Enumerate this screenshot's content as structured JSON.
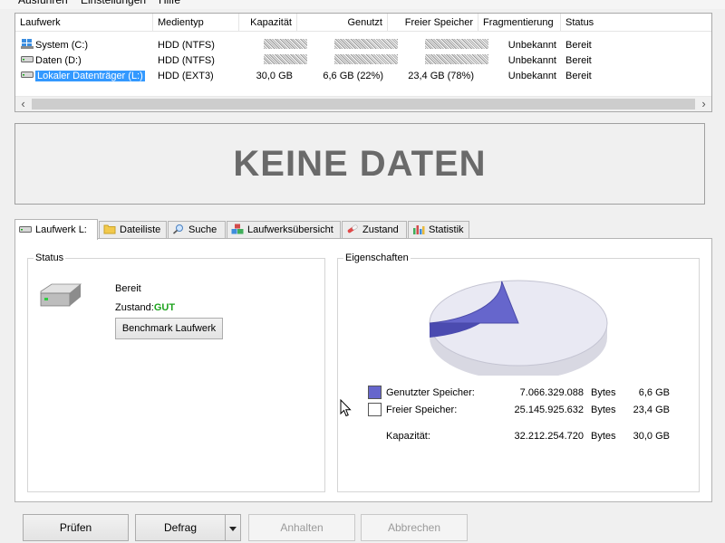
{
  "menu": {
    "items": [
      "Ausführen",
      "Einstellungen",
      "Hilfe"
    ]
  },
  "drive_list": {
    "columns": [
      "Laufwerk",
      "Medientyp",
      "Kapazität",
      "Genutzt",
      "Freier Speicher",
      "Fragmentierung",
      "Status"
    ],
    "rows": [
      {
        "laufwerk": "System (C:)",
        "medientyp": "HDD (NTFS)",
        "kapazitaet": "",
        "genutzt": "",
        "frei": "",
        "fragmentierung": "Unbekannt",
        "status": "Bereit",
        "icon": "windows-drive-icon",
        "selected": false,
        "redacted": true
      },
      {
        "laufwerk": "Daten (D:)",
        "medientyp": "HDD (NTFS)",
        "kapazitaet": "",
        "genutzt": "",
        "frei": "",
        "fragmentierung": "Unbekannt",
        "status": "Bereit",
        "icon": "hard-drive-icon",
        "selected": false,
        "redacted": true
      },
      {
        "laufwerk": "Lokaler Datenträger (L:)",
        "medientyp": "HDD (EXT3)",
        "kapazitaet": "30,0 GB",
        "genutzt": "6,6 GB (22%)",
        "frei": "23,4 GB (78%)",
        "fragmentierung": "Unbekannt",
        "status": "Bereit",
        "icon": "hard-drive-icon",
        "selected": true,
        "redacted": false
      }
    ]
  },
  "banner": {
    "text": "KEINE DATEN"
  },
  "tabs": [
    {
      "label": "Laufwerk L:",
      "icon": "drive-icon",
      "active": true
    },
    {
      "label": "Dateiliste",
      "icon": "folder-icon",
      "active": false
    },
    {
      "label": "Suche",
      "icon": "magnifier-icon",
      "active": false
    },
    {
      "label": "Laufwerksübersicht",
      "icon": "blocks-icon",
      "active": false
    },
    {
      "label": "Zustand",
      "icon": "health-icon",
      "active": false
    },
    {
      "label": "Statistik",
      "icon": "bar-chart-icon",
      "active": false
    }
  ],
  "status_group": {
    "title": "Status",
    "state": "Bereit",
    "condition_label": "Zustand:",
    "condition_value": "GUT",
    "condition_color": "#1ea31e",
    "benchmark_button": "Benchmark Laufwerk"
  },
  "properties": {
    "title": "Eigenschaften",
    "used": {
      "label": "Genutzter Speicher:",
      "bytes": "7.066.329.088",
      "unit": "Bytes",
      "size": "6,6 GB",
      "color": "#6666cc"
    },
    "free": {
      "label": "Freier Speicher:",
      "bytes": "25.145.925.632",
      "unit": "Bytes",
      "size": "23,4 GB",
      "color": "#ffffff"
    },
    "capacity": {
      "label": "Kapazität:",
      "bytes": "32.212.254.720",
      "unit": "Bytes",
      "size": "30,0 GB"
    },
    "used_fraction": 0.22
  },
  "buttons": {
    "check": "Prüfen",
    "defrag": "Defrag",
    "pause": "Anhalten",
    "cancel": "Abbrechen"
  }
}
